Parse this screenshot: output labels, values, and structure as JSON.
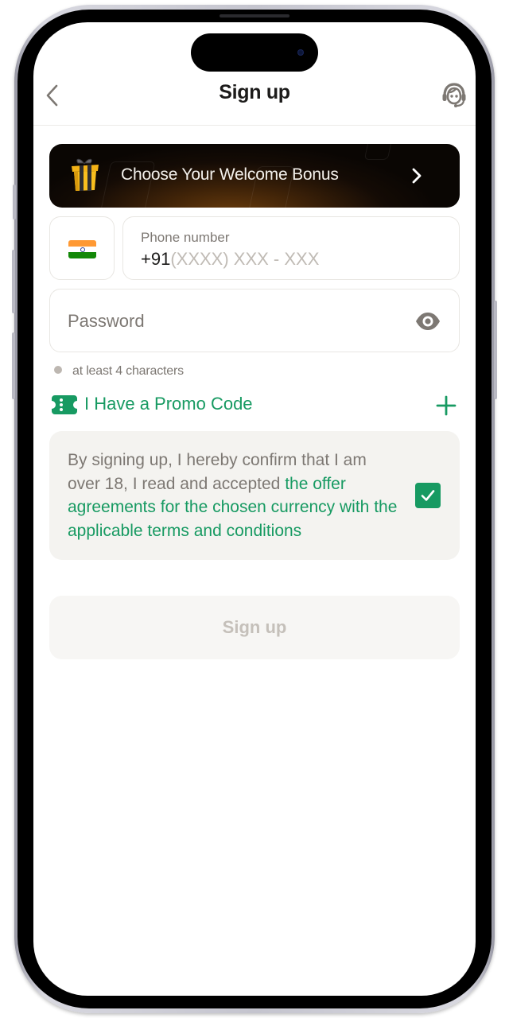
{
  "header": {
    "title": "Sign up",
    "back_icon": "chevron-left-icon",
    "support_icon": "headset-support-icon"
  },
  "bonus_banner": {
    "label": "Choose Your Welcome Bonus",
    "icon": "gift-icon",
    "chevron": "chevron-right-icon"
  },
  "phone": {
    "country_flag": "india-flag-icon",
    "label": "Phone number",
    "prefix": "+91",
    "placeholder": "(XXXX) XXX - XXX"
  },
  "password": {
    "placeholder": "Password",
    "visibility_icon": "eye-icon",
    "hint": "at least 4 characters"
  },
  "promo": {
    "label": "I Have a Promo Code",
    "icon": "ticket-icon",
    "action_icon": "plus-icon"
  },
  "terms": {
    "text_plain": "By signing up, I hereby confirm that I am over 18, I read and accepted ",
    "text_link": "the offer agreements for the chosen currency with the applicable terms and conditions",
    "checked": true
  },
  "submit": {
    "label": "Sign up",
    "enabled": false
  },
  "colors": {
    "accent": "#179a62",
    "text_primary": "#1c1b1a",
    "text_secondary": "#7d7873",
    "disabled_text": "#c5c0ba",
    "surface_muted": "#f4f3f0"
  }
}
